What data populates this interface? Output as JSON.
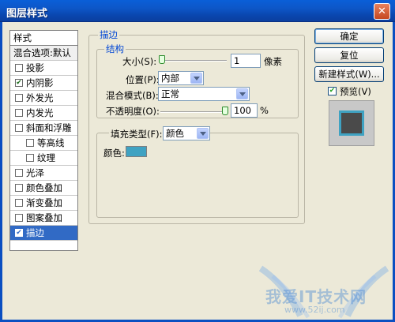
{
  "window": {
    "title": "图层样式",
    "close_glyph": "✕"
  },
  "style_list": {
    "header": "样式",
    "blend_options": "混合选项:默认",
    "items": [
      {
        "label": "投影",
        "checked": false,
        "indent": false
      },
      {
        "label": "内阴影",
        "checked": true,
        "indent": false
      },
      {
        "label": "外发光",
        "checked": false,
        "indent": false
      },
      {
        "label": "内发光",
        "checked": false,
        "indent": false
      },
      {
        "label": "斜面和浮雕",
        "checked": false,
        "indent": false
      },
      {
        "label": "等高线",
        "checked": false,
        "indent": true
      },
      {
        "label": "纹理",
        "checked": false,
        "indent": true
      },
      {
        "label": "光泽",
        "checked": false,
        "indent": false
      },
      {
        "label": "颜色叠加",
        "checked": false,
        "indent": false
      },
      {
        "label": "渐变叠加",
        "checked": false,
        "indent": false
      },
      {
        "label": "图案叠加",
        "checked": false,
        "indent": false
      },
      {
        "label": "描边",
        "checked": true,
        "indent": false,
        "selected": true
      }
    ]
  },
  "stroke": {
    "group_title": "描边",
    "structure_title": "结构",
    "size_label": "大小(S):",
    "size_value": "1",
    "size_unit": "像素",
    "size_fraction": 0.0,
    "position_label": "位置(P):",
    "position_value": "内部",
    "blend_label": "混合模式(B):",
    "blend_value": "正常",
    "opacity_label": "不透明度(O):",
    "opacity_value": "100",
    "opacity_unit": "%",
    "opacity_fraction": 1.0,
    "fill_label": "填充类型(F):",
    "fill_value": "颜色",
    "color_label": "颜色:",
    "color_hex": "#3fa2c2"
  },
  "buttons": {
    "ok": "确定",
    "reset": "复位",
    "new_style": "新建样式(W)...",
    "preview": "预览(V)",
    "preview_checked": true
  },
  "watermark": {
    "text": "我爱IT技术网",
    "url": "www.52ij.com"
  }
}
